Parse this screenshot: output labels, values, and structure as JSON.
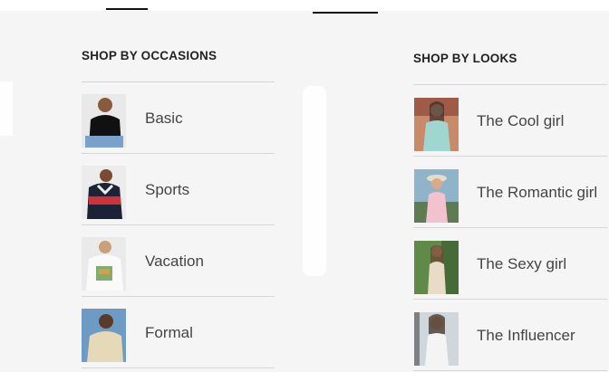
{
  "occasions": {
    "title": "SHOP BY OCCASIONS",
    "items": [
      {
        "label": "Basic",
        "image": "man-black-tshirt-image"
      },
      {
        "label": "Sports",
        "image": "man-sports-jacket-image"
      },
      {
        "label": "Vacation",
        "image": "man-graphic-tee-image"
      },
      {
        "label": "Formal",
        "image": "man-formal-shirt-image"
      }
    ]
  },
  "looks": {
    "title": "SHOP BY LOOKS",
    "items": [
      {
        "label": "The Cool girl",
        "image": "woman-cool-outfit-image"
      },
      {
        "label": "The Romantic girl",
        "image": "woman-romantic-outfit-image"
      },
      {
        "label": "The Sexy girl",
        "image": "woman-sexy-outfit-image"
      },
      {
        "label": "The Influencer",
        "image": "woman-influencer-outfit-image"
      }
    ]
  },
  "colors": {
    "background": "#f5f5f5",
    "divider": "#d6d6d6",
    "title_text": "#222222",
    "item_text": "#444444"
  }
}
